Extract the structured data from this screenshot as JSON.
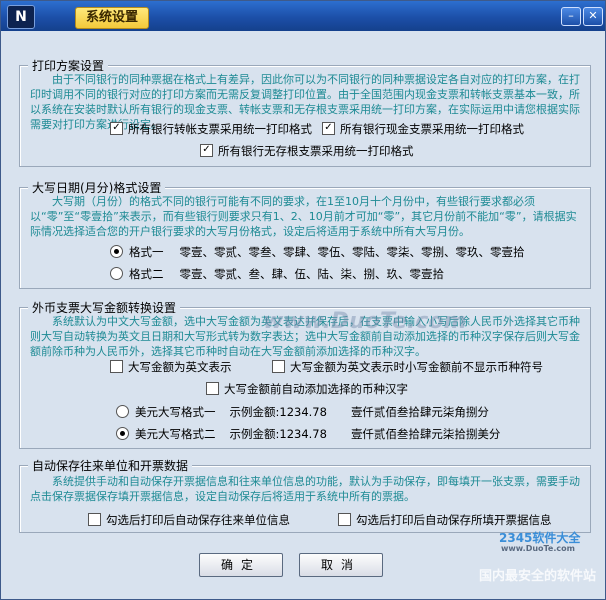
{
  "window": {
    "title": "系统设置",
    "logo_text": "N"
  },
  "print_group": {
    "title": "打印方案设置",
    "description": "由于不同银行的同种票据在格式上有差异，因此你可以为不同银行的同种票据设定各自对应的打印方案，在打印时调用不同的银行对应的打印方案而无需反复调整打印位置。由于全国范围内现金支票和转帐支票基本一致，所以系统在安装时默认所有银行的现金支票、转帐支票和无存根支票采用统一打印方案，在实际运用中请您根据实际需要对打印方案进行设定。",
    "options": [
      {
        "label": "所有银行转帐支票采用统一打印格式",
        "checked": true
      },
      {
        "label": "所有银行现金支票采用统一打印格式",
        "checked": true
      },
      {
        "label": "所有银行无存根支票采用统一打印格式",
        "checked": true
      }
    ]
  },
  "date_group": {
    "title": "大写日期(月分)格式设置",
    "description": "大写期（月份）的格式不同的银行可能有不同的要求，在1至10月十个月份中，有些银行要求都必须以“零”至“零壹拾”来表示，而有些银行则要求只有1、2、10月前才可加“零”，其它月份前不能加“零”，请根据实际情况选择适合您的开户银行要求的大写月份格式，设定后将适用于系统中所有大写月份。",
    "formats": [
      {
        "label": "格式一",
        "values": "零壹、零贰、零叁、零肆、零伍、零陆、零柒、零捌、零玖、零壹拾",
        "selected": true
      },
      {
        "label": "格式二",
        "values": "零壹、零贰、叁、肆、伍、陆、柒、捌、玖、零壹拾",
        "selected": false
      }
    ]
  },
  "currency_group": {
    "title": "外币支票大写金额转换设置",
    "description": "系统默认为中文大写金额，选中大写金额为英文表达并保存后，在支票中输入小写后除人民币外选择其它币种则大写自动转换为英文且日期和大写形式转为数字表达；选中大写金额前自动添加选择的币种汉字保存后则大写金额前除币种为人民币外，选择其它币种时自动在大写金额前添加选择的币种汉字。",
    "options": [
      {
        "label": "大写金额为英文表示",
        "checked": false
      },
      {
        "label": "大写金额为英文表示时小写金额前不显示币种符号",
        "checked": false
      },
      {
        "label": "大写金额前自动添加选择的币种汉字",
        "checked": false
      }
    ],
    "formats": [
      {
        "label": "美元大写格式一",
        "example_label": "示例金额:1234.78",
        "example_value": "壹仟贰佰叁拾肆元柒角捌分",
        "selected": false
      },
      {
        "label": "美元大写格式二",
        "example_label": "示例金额:1234.78",
        "example_value": "壹仟贰佰叁拾肆元柒拾捌美分",
        "selected": true
      }
    ]
  },
  "autosave_group": {
    "title": "自动保存往来单位和开票数据",
    "description": "系统提供手动和自动保存开票据信息和往来单位信息的功能，默认为手动保存，即每填开一张支票，需要手动点击保存票据保存填开票据信息，设定自动保存后将适用于系统中所有的票据。",
    "options": [
      {
        "label": "勾选后打印后自动保存往来单位信息",
        "checked": false
      },
      {
        "label": "勾选后打印后自动保存所填开票据信息",
        "checked": false
      }
    ]
  },
  "buttons": {
    "ok": "确定",
    "cancel": "取消"
  },
  "watermarks": {
    "site": "www.DuoTe.com",
    "brand": "2345软件大全",
    "slogan": "国内最安全的软件站",
    "small_url": "www.DuoTe.com"
  }
}
